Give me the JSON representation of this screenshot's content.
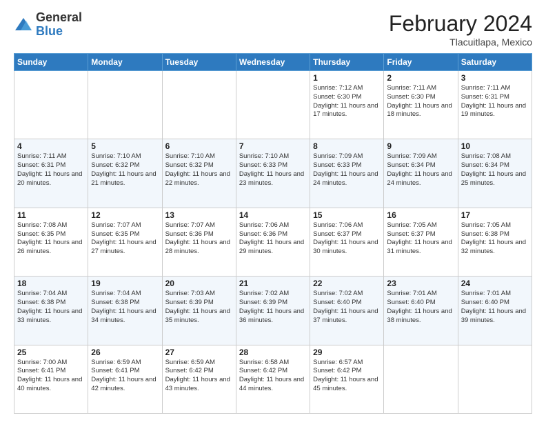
{
  "header": {
    "logo_general": "General",
    "logo_blue": "Blue",
    "month_title": "February 2024",
    "location": "Tlacuitlapa, Mexico"
  },
  "days_of_week": [
    "Sunday",
    "Monday",
    "Tuesday",
    "Wednesday",
    "Thursday",
    "Friday",
    "Saturday"
  ],
  "weeks": [
    [
      {
        "day": "",
        "info": ""
      },
      {
        "day": "",
        "info": ""
      },
      {
        "day": "",
        "info": ""
      },
      {
        "day": "",
        "info": ""
      },
      {
        "day": "1",
        "info": "Sunrise: 7:12 AM\nSunset: 6:30 PM\nDaylight: 11 hours and 17 minutes."
      },
      {
        "day": "2",
        "info": "Sunrise: 7:11 AM\nSunset: 6:30 PM\nDaylight: 11 hours and 18 minutes."
      },
      {
        "day": "3",
        "info": "Sunrise: 7:11 AM\nSunset: 6:31 PM\nDaylight: 11 hours and 19 minutes."
      }
    ],
    [
      {
        "day": "4",
        "info": "Sunrise: 7:11 AM\nSunset: 6:31 PM\nDaylight: 11 hours and 20 minutes."
      },
      {
        "day": "5",
        "info": "Sunrise: 7:10 AM\nSunset: 6:32 PM\nDaylight: 11 hours and 21 minutes."
      },
      {
        "day": "6",
        "info": "Sunrise: 7:10 AM\nSunset: 6:32 PM\nDaylight: 11 hours and 22 minutes."
      },
      {
        "day": "7",
        "info": "Sunrise: 7:10 AM\nSunset: 6:33 PM\nDaylight: 11 hours and 23 minutes."
      },
      {
        "day": "8",
        "info": "Sunrise: 7:09 AM\nSunset: 6:33 PM\nDaylight: 11 hours and 24 minutes."
      },
      {
        "day": "9",
        "info": "Sunrise: 7:09 AM\nSunset: 6:34 PM\nDaylight: 11 hours and 24 minutes."
      },
      {
        "day": "10",
        "info": "Sunrise: 7:08 AM\nSunset: 6:34 PM\nDaylight: 11 hours and 25 minutes."
      }
    ],
    [
      {
        "day": "11",
        "info": "Sunrise: 7:08 AM\nSunset: 6:35 PM\nDaylight: 11 hours and 26 minutes."
      },
      {
        "day": "12",
        "info": "Sunrise: 7:07 AM\nSunset: 6:35 PM\nDaylight: 11 hours and 27 minutes."
      },
      {
        "day": "13",
        "info": "Sunrise: 7:07 AM\nSunset: 6:36 PM\nDaylight: 11 hours and 28 minutes."
      },
      {
        "day": "14",
        "info": "Sunrise: 7:06 AM\nSunset: 6:36 PM\nDaylight: 11 hours and 29 minutes."
      },
      {
        "day": "15",
        "info": "Sunrise: 7:06 AM\nSunset: 6:37 PM\nDaylight: 11 hours and 30 minutes."
      },
      {
        "day": "16",
        "info": "Sunrise: 7:05 AM\nSunset: 6:37 PM\nDaylight: 11 hours and 31 minutes."
      },
      {
        "day": "17",
        "info": "Sunrise: 7:05 AM\nSunset: 6:38 PM\nDaylight: 11 hours and 32 minutes."
      }
    ],
    [
      {
        "day": "18",
        "info": "Sunrise: 7:04 AM\nSunset: 6:38 PM\nDaylight: 11 hours and 33 minutes."
      },
      {
        "day": "19",
        "info": "Sunrise: 7:04 AM\nSunset: 6:38 PM\nDaylight: 11 hours and 34 minutes."
      },
      {
        "day": "20",
        "info": "Sunrise: 7:03 AM\nSunset: 6:39 PM\nDaylight: 11 hours and 35 minutes."
      },
      {
        "day": "21",
        "info": "Sunrise: 7:02 AM\nSunset: 6:39 PM\nDaylight: 11 hours and 36 minutes."
      },
      {
        "day": "22",
        "info": "Sunrise: 7:02 AM\nSunset: 6:40 PM\nDaylight: 11 hours and 37 minutes."
      },
      {
        "day": "23",
        "info": "Sunrise: 7:01 AM\nSunset: 6:40 PM\nDaylight: 11 hours and 38 minutes."
      },
      {
        "day": "24",
        "info": "Sunrise: 7:01 AM\nSunset: 6:40 PM\nDaylight: 11 hours and 39 minutes."
      }
    ],
    [
      {
        "day": "25",
        "info": "Sunrise: 7:00 AM\nSunset: 6:41 PM\nDaylight: 11 hours and 40 minutes."
      },
      {
        "day": "26",
        "info": "Sunrise: 6:59 AM\nSunset: 6:41 PM\nDaylight: 11 hours and 42 minutes."
      },
      {
        "day": "27",
        "info": "Sunrise: 6:59 AM\nSunset: 6:42 PM\nDaylight: 11 hours and 43 minutes."
      },
      {
        "day": "28",
        "info": "Sunrise: 6:58 AM\nSunset: 6:42 PM\nDaylight: 11 hours and 44 minutes."
      },
      {
        "day": "29",
        "info": "Sunrise: 6:57 AM\nSunset: 6:42 PM\nDaylight: 11 hours and 45 minutes."
      },
      {
        "day": "",
        "info": ""
      },
      {
        "day": "",
        "info": ""
      }
    ]
  ]
}
